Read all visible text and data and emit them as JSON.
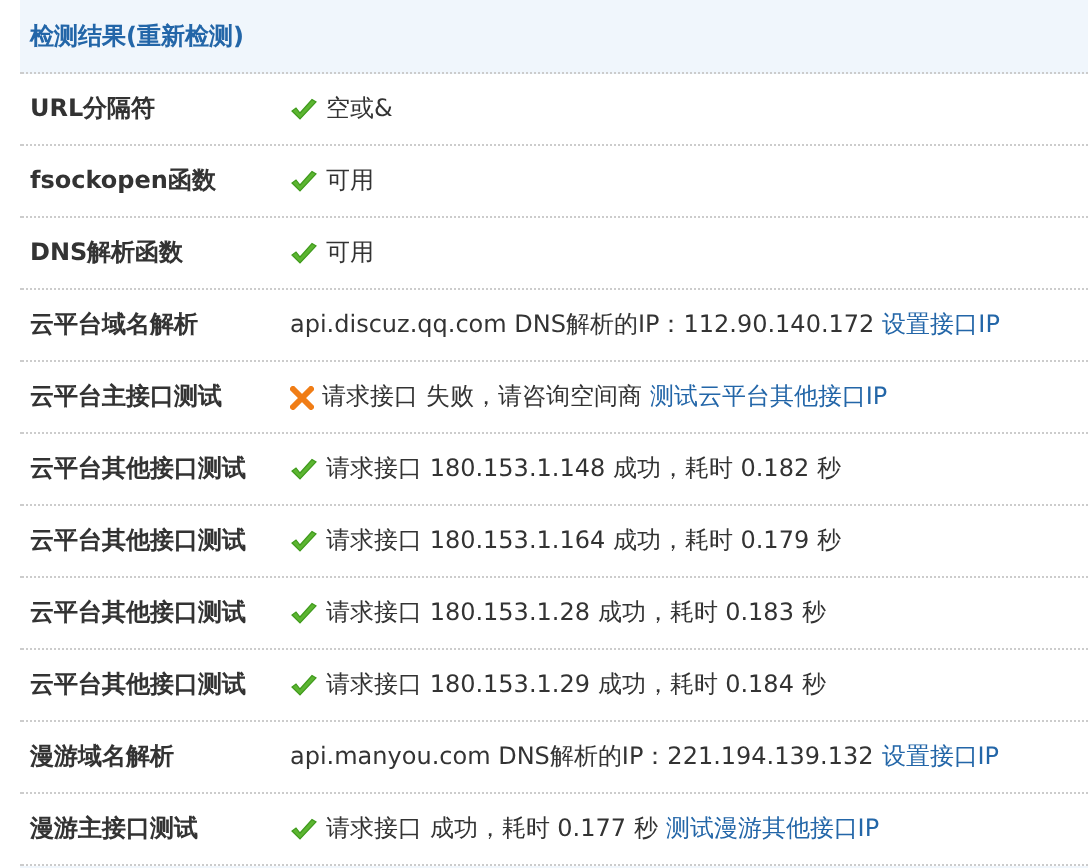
{
  "title": "检测结果(重新检测)",
  "rows": [
    {
      "label": "URL分隔符",
      "kind": "passed",
      "text": "空或&"
    },
    {
      "label": "fsockopen函数",
      "kind": "passed",
      "text": "可用"
    },
    {
      "label": "DNS解析函数",
      "kind": "passed",
      "text": "可用"
    },
    {
      "label": "云平台域名解析",
      "kind": "plain",
      "text": "api.discuz.qq.com DNS解析的IP：112.90.140.172",
      "link": "设置接口IP"
    },
    {
      "label": "云平台主接口测试",
      "kind": "failed",
      "text": "请求接口 失败，请咨询空间商",
      "link": "测试云平台其他接口IP"
    },
    {
      "label": "云平台其他接口测试",
      "kind": "passed",
      "text": "请求接口 180.153.1.148 成功，耗时 0.182 秒"
    },
    {
      "label": "云平台其他接口测试",
      "kind": "passed",
      "text": "请求接口 180.153.1.164 成功，耗时 0.179 秒"
    },
    {
      "label": "云平台其他接口测试",
      "kind": "passed",
      "text": "请求接口 180.153.1.28 成功，耗时 0.183 秒"
    },
    {
      "label": "云平台其他接口测试",
      "kind": "passed",
      "text": "请求接口 180.153.1.29 成功，耗时 0.184 秒"
    },
    {
      "label": "漫游域名解析",
      "kind": "plain",
      "text": "api.manyou.com DNS解析的IP：221.194.139.132",
      "link": "设置接口IP"
    },
    {
      "label": "漫游主接口测试",
      "kind": "passed",
      "text": "请求接口 成功，耗时 0.177 秒",
      "link": "测试漫游其他接口IP"
    }
  ]
}
